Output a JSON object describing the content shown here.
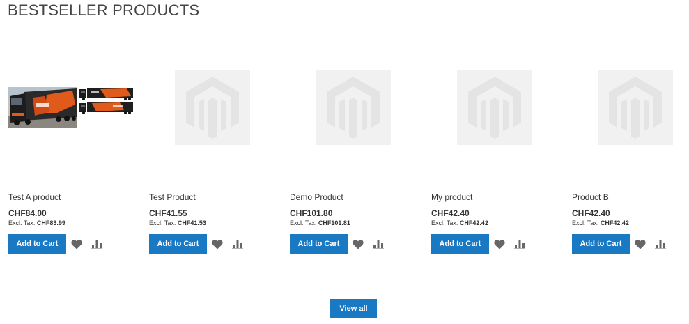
{
  "section": {
    "title": "BESTSELLER PRODUCTS"
  },
  "colors": {
    "accent": "#1979c3",
    "icon": "#666666",
    "placeholder_bg": "#f1f1f1"
  },
  "products": [
    {
      "name": "Test A product",
      "price": "CHF84.00",
      "excl_label": "Excl. Tax:",
      "excl_value": "CHF83.99",
      "button": "Add to Cart",
      "image": "truck-photo"
    },
    {
      "name": "Test Product",
      "price": "CHF41.55",
      "excl_label": "Excl. Tax:",
      "excl_value": "CHF41.53",
      "button": "Add to Cart",
      "image": "placeholder"
    },
    {
      "name": "Demo Product",
      "price": "CHF101.80",
      "excl_label": "Excl. Tax:",
      "excl_value": "CHF101.81",
      "button": "Add to Cart",
      "image": "placeholder"
    },
    {
      "name": "My product",
      "price": "CHF42.40",
      "excl_label": "Excl. Tax:",
      "excl_value": "CHF42.42",
      "button": "Add to Cart",
      "image": "placeholder"
    },
    {
      "name": "Product B",
      "price": "CHF42.40",
      "excl_label": "Excl. Tax:",
      "excl_value": "CHF42.42",
      "button": "Add to Cart",
      "image": "placeholder"
    }
  ],
  "icons": {
    "wishlist": "heart-icon",
    "compare": "bar-chart-icon"
  },
  "footer": {
    "view_all": "View all"
  }
}
